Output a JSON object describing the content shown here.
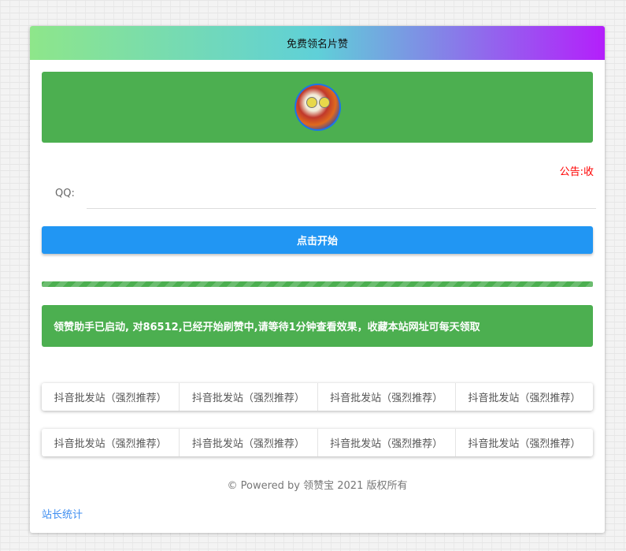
{
  "header": {
    "title": "免费领名片赞"
  },
  "notice": "公告:收",
  "form": {
    "qq_label": "QQ:",
    "qq_value": "",
    "start_button": "点击开始"
  },
  "progress": {
    "percent": 100
  },
  "alert": "领赞助手已启动, 对86512,已经开始刷赞中,请等待1分钟查看效果，收藏本站网址可每天领取",
  "link_rows": [
    [
      "抖音批发站（强烈推荐）",
      "抖音批发站（强烈推荐）",
      "抖音批发站（强烈推荐）",
      "抖音批发站（强烈推荐）"
    ],
    [
      "抖音批发站（强烈推荐）",
      "抖音批发站（强烈推荐）",
      "抖音批发站（强烈推荐）",
      "抖音批发站（强烈推荐）"
    ]
  ],
  "footer": "© Powered by 领赞宝 2021 版权所有",
  "stats_link": "站长统计",
  "colors": {
    "green": "#4caf50",
    "blue": "#2196f3",
    "notice": "#ff0000"
  }
}
